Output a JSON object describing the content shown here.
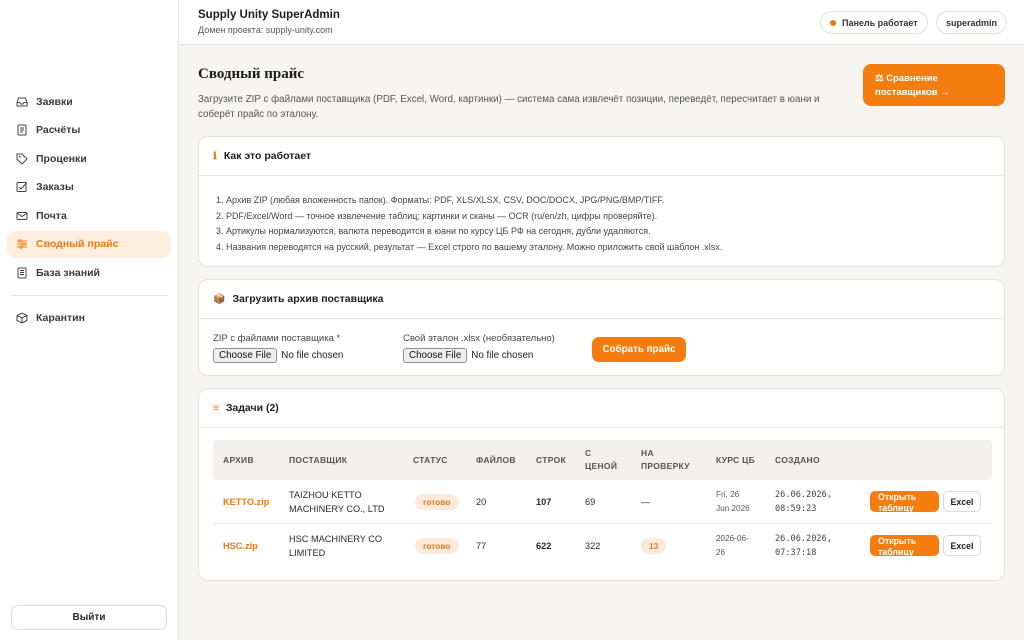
{
  "header": {
    "title": "Supply Unity SuperAdmin",
    "domain": "Домен проекта: supply-unity.com",
    "status": "Панель работает",
    "user": "superadmin"
  },
  "sidebar": {
    "items": [
      {
        "label": "Заявки",
        "icon": "inbox-icon"
      },
      {
        "label": "Расчёты",
        "icon": "document-icon"
      },
      {
        "label": "Проценки",
        "icon": "tag-icon"
      },
      {
        "label": "Заказы",
        "icon": "checkbox-icon"
      },
      {
        "label": "Почта",
        "icon": "mail-icon"
      },
      {
        "label": "Сводный прайс",
        "icon": "sliders-icon",
        "active": true
      },
      {
        "label": "База знаний",
        "icon": "book-icon"
      }
    ],
    "extra_items": [
      {
        "label": "Карантин",
        "icon": "cube-icon"
      }
    ],
    "logout": "Выйти"
  },
  "page": {
    "title": "Сводный прайс",
    "description": "Загрузите ZIP с файлами поставщика (PDF, Excel, Word, картинки) — система сама извлечёт позиции, переведёт, пересчитает в юани и соберёт прайс по эталону.",
    "compare_button": "⚖ Сравнение поставщиков →"
  },
  "how": {
    "title": "Как это работает",
    "steps": [
      "1. Архив ZIP (любая вложенность папок). Форматы: PDF, XLS/XLSX, CSV, DOC/DOCX, JPG/PNG/BMP/TIFF.",
      "2. PDF/Excel/Word — точное извлечение таблиц; картинки и сканы — OCR (ru/en/zh, цифры проверяйте).",
      "3. Артикулы нормализуются, валюта переводится в юани по курсу ЦБ РФ на сегодня, дубли удаляются.",
      "4. Названия переводятся на русский, результат — Excel строго по вашему эталону. Можно приложить свой шаблон .xlsx."
    ]
  },
  "upload": {
    "title": "Загрузить архив поставщика",
    "zip_label": "ZIP с файлами поставщика *",
    "template_label": "Свой эталон .xlsx (необязательно)",
    "choose_file": "Choose File",
    "no_file": "No file chosen",
    "submit": "Собрать прайс"
  },
  "tasks": {
    "title": "Задачи (2)",
    "columns": [
      "АРХИВ",
      "ПОСТАВЩИК",
      "СТАТУС",
      "ФАЙЛОВ",
      "СТРОК",
      "С\nЦЕНОЙ",
      "НА\nПРОВЕРКУ",
      "КУРС ЦБ",
      "СОЗДАНО"
    ],
    "rows": [
      {
        "archive": "KETTO.zip",
        "supplier_1": "TAIZHOU KETTO",
        "supplier_2": "MACHINERY CO., LTD",
        "status": "готово",
        "files": "20",
        "lines": "107",
        "with_price": "69",
        "review": "—",
        "rate_1": "Fri, 26",
        "rate_2": "Jun 2026",
        "created_1": "26.06.2026,",
        "created_2": "08:59:23",
        "open": "Открыть таблицу",
        "excel": "Excel"
      },
      {
        "archive": "HSC.zip",
        "supplier_1": "HSC MACHINERY CO",
        "supplier_2": "LIMITED",
        "status": "готово",
        "files": "77",
        "lines": "622",
        "with_price": "322",
        "review": "13",
        "rate_1": "2026-06-",
        "rate_2": "26",
        "created_1": "26.06.2026,",
        "created_2": "07:37:18",
        "open": "Открыть таблицу",
        "excel": "Excel"
      }
    ]
  },
  "colors": {
    "accent": "#f57c0e",
    "active_bg": "#fdeedd",
    "badge_bg": "#fbeadb"
  }
}
